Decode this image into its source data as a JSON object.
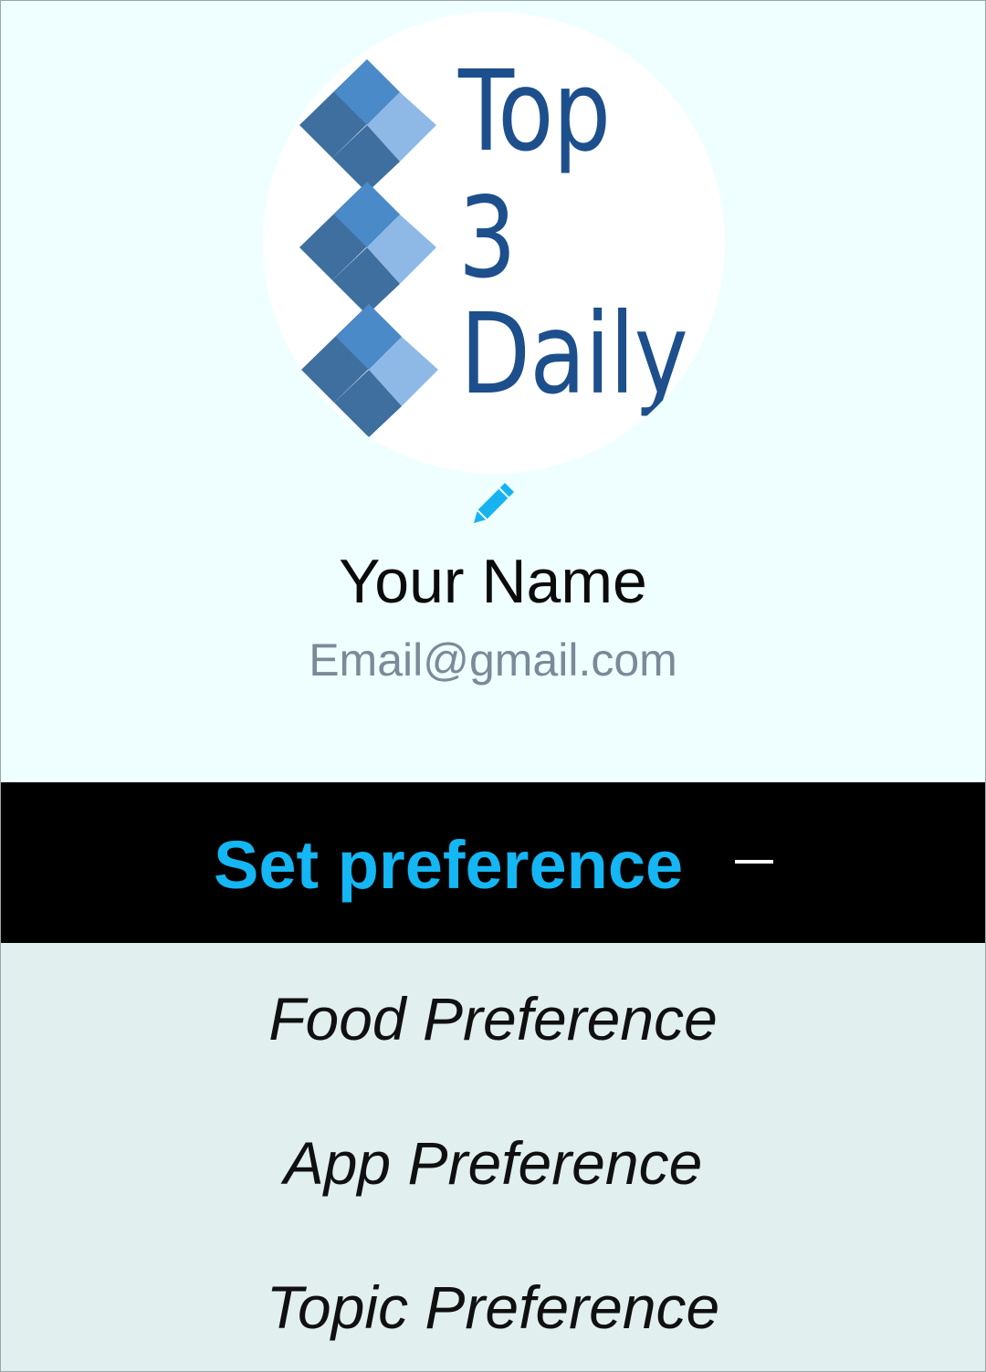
{
  "profile": {
    "logo": {
      "line1": "Top",
      "line2": "3",
      "line3": "Daily"
    },
    "name": "Your Name",
    "email": "Email@gmail.com"
  },
  "preferences": {
    "header_label": "Set preference",
    "items": [
      {
        "label": "Food Preference"
      },
      {
        "label": "App Preference"
      },
      {
        "label": "Topic Preference"
      }
    ]
  },
  "icons": {
    "edit": "pencil-icon",
    "collapse": "minus-icon"
  },
  "colors": {
    "accent": "#14b6f4",
    "logo_text": "#1d4f8c",
    "header_bg": "#000000",
    "list_bg": "#e1efef",
    "profile_bg": "#efffff"
  }
}
